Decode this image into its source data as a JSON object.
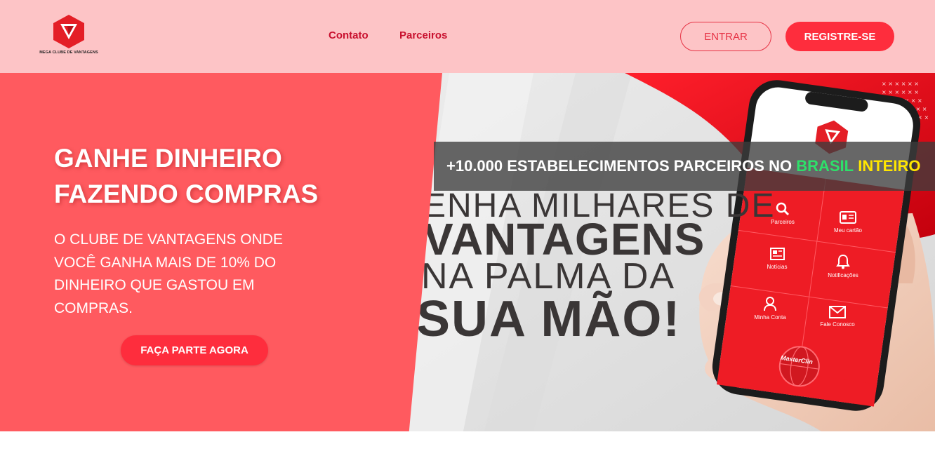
{
  "header": {
    "logo_text": "MEGA CLUBE DE VANTAGENS",
    "nav": [
      {
        "label": "Contato"
      },
      {
        "label": "Parceiros"
      }
    ],
    "login_label": "ENTRAR",
    "register_label": "REGISTRE-SE"
  },
  "hero": {
    "headline_line1": "GANHE DINHEIRO",
    "headline_line2": "FAZENDO COMPRAS",
    "subline": "O CLUBE DE VANTAGENS ONDE VOCÊ GANHA MAIS DE 10% DO DINHEIRO QUE GASTOU EM COMPRAS.",
    "cta_label": "FAÇA PARTE AGORA",
    "banner": {
      "prefix": "+10.000 ESTABELECIMENTOS PARCEIROS NO",
      "word_green": "BRASIL",
      "word_yellow": "INTEIRO"
    },
    "image_text": {
      "line1": "ENHA MILHARES DE",
      "line2": "VANTAGENS",
      "line3": "NA PALMA DA",
      "line4": "SUA MÃO!"
    },
    "phone_app": {
      "items": [
        {
          "label": "Parceiros",
          "icon": "search-icon"
        },
        {
          "label": "Meu cartão",
          "icon": "card-icon"
        },
        {
          "label": "Notícias",
          "icon": "newspaper-icon"
        },
        {
          "label": "Notificações",
          "icon": "bell-icon"
        },
        {
          "label": "Minha Conta",
          "icon": "user-icon"
        },
        {
          "label": "Fale Conosco",
          "icon": "mail-icon"
        }
      ],
      "badge": "MasterClin"
    }
  },
  "colors": {
    "header_bg": "#fdc4c6",
    "hero_left_bg": "#ff5a5f",
    "brand_red": "#fe2d3d",
    "nav_red": "#c8102e",
    "banner_green": "#2ee06a",
    "banner_yellow": "#ffe600"
  }
}
